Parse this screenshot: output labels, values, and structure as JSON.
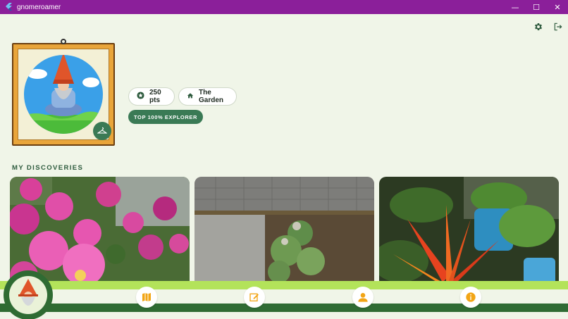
{
  "window": {
    "title": "gnomeroamer",
    "minimize": "—",
    "maximize": "☐",
    "close": "✕"
  },
  "profile": {
    "points_label": "250 pts",
    "location_label": "The Garden",
    "rank_label": "TOP 100% EXPLORER"
  },
  "discoveries": {
    "title": "MY DISCOVERIES"
  },
  "colors": {
    "title_bar": "#8b1f9a",
    "accent_green": "#3a7a55",
    "nav_light": "#b3e35a",
    "nav_dark": "#2f6b33",
    "nav_icon": "#f2a516",
    "background": "#f0f5e8"
  },
  "icons": {
    "settings": "gear-icon",
    "logout": "logout-icon",
    "points": "star-circle-icon",
    "location": "home-icon",
    "edit_avatar": "hanger-icon",
    "nav_map": "map-icon",
    "nav_edit": "edit-note-icon",
    "nav_profile": "person-icon",
    "nav_info": "info-icon"
  }
}
